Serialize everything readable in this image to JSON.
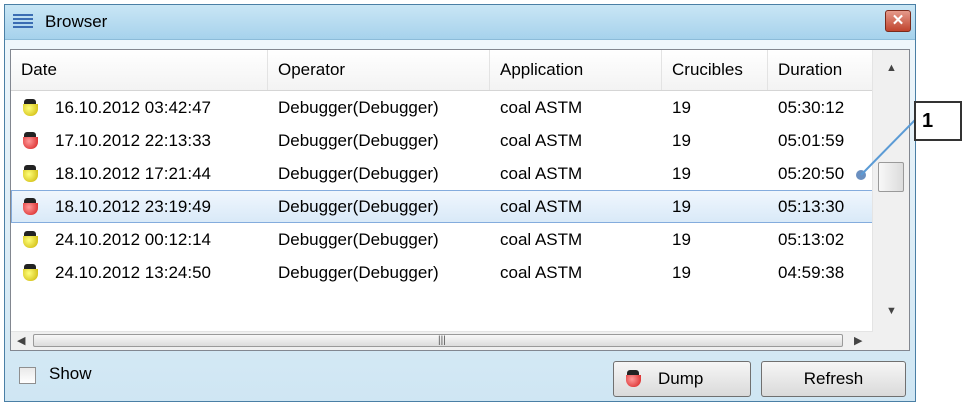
{
  "window": {
    "title": "Browser",
    "close_label": "✕"
  },
  "columns": [
    "Date",
    "Operator",
    "Application",
    "Crucibles",
    "Duration"
  ],
  "rows": [
    {
      "icon": "yellow",
      "date": "16.10.2012 03:42:47",
      "operator": "Debugger(Debugger)",
      "application": "coal ASTM",
      "crucibles": "19",
      "duration": "05:30:12"
    },
    {
      "icon": "red",
      "date": "17.10.2012 22:13:33",
      "operator": "Debugger(Debugger)",
      "application": "coal ASTM",
      "crucibles": "19",
      "duration": "05:01:59"
    },
    {
      "icon": "yellow",
      "date": "18.10.2012 17:21:44",
      "operator": "Debugger(Debugger)",
      "application": "coal ASTM",
      "crucibles": "19",
      "duration": "05:20:50"
    },
    {
      "icon": "red",
      "date": "18.10.2012 23:19:49",
      "operator": "Debugger(Debugger)",
      "application": "coal ASTM",
      "crucibles": "19",
      "duration": "05:13:30",
      "selected": true
    },
    {
      "icon": "yellow",
      "date": "24.10.2012 00:12:14",
      "operator": "Debugger(Debugger)",
      "application": "coal ASTM",
      "crucibles": "19",
      "duration": "05:13:02"
    },
    {
      "icon": "yellow",
      "date": "24.10.2012 13:24:50",
      "operator": "Debugger(Debugger)",
      "application": "coal ASTM",
      "crucibles": "19",
      "duration": "04:59:38"
    }
  ],
  "footer": {
    "show_label": "Show",
    "show_checked": false,
    "dump_label": "Dump",
    "refresh_label": "Refresh"
  },
  "callout": {
    "label": "1"
  },
  "colors": {
    "titlebar": "#a6d2ec",
    "selection_border": "#84acdd",
    "callout_line": "#5b9bd5"
  },
  "icons": {
    "app": "list-icon",
    "close": "close-icon",
    "row": "crucible-icon"
  }
}
